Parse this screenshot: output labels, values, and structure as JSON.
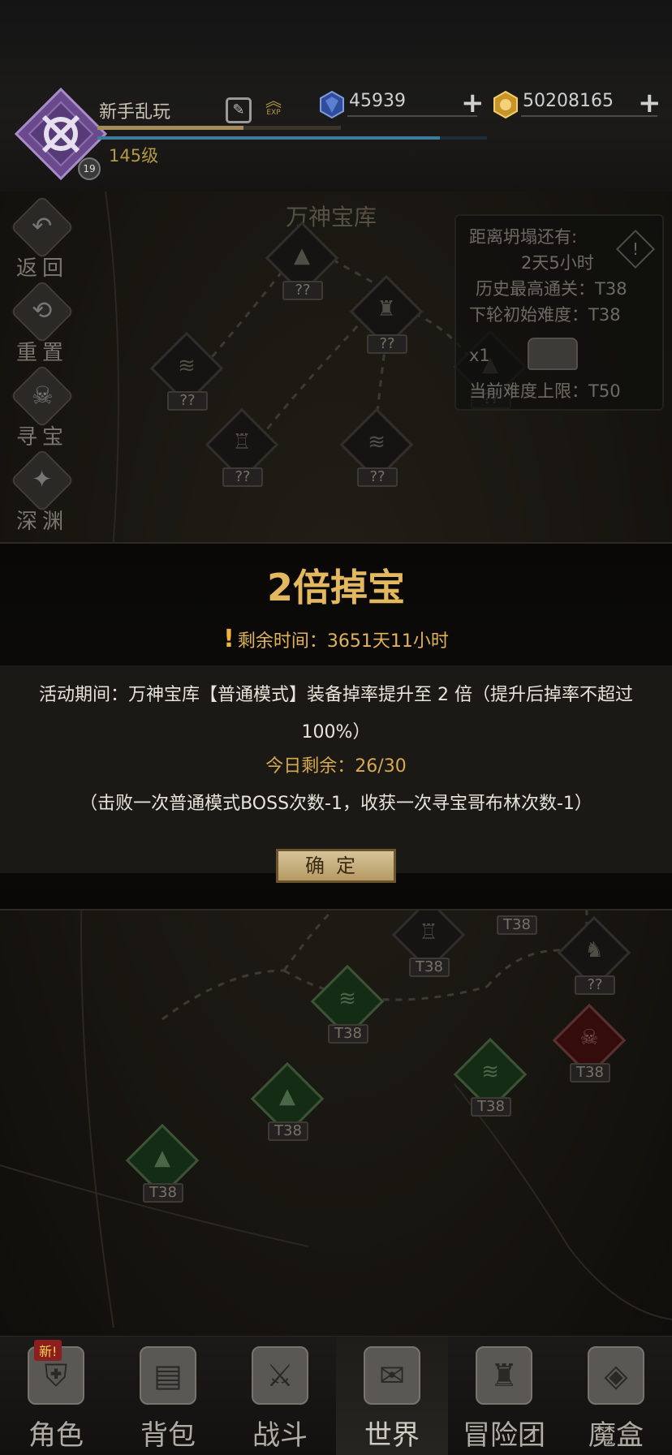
{
  "header": {
    "player_name": "新手乱玩",
    "player_level": "145级",
    "avatar_badge": "19",
    "exp_icon_label": "EXP",
    "exp_progress": 0.6,
    "mana_progress": 0.88,
    "currencies": [
      {
        "name": "diamond",
        "value": "45939",
        "icon": "blue-crystal-icon",
        "color": "#3d5fb5"
      },
      {
        "name": "gold",
        "value": "50208165",
        "icon": "gold-coin-icon",
        "color": "#d4a93a"
      }
    ]
  },
  "map": {
    "title": "万神宝库",
    "side_menu": [
      {
        "label": "返回",
        "icon": "return-arrow-icon"
      },
      {
        "label": "重置",
        "icon": "reset-icon"
      },
      {
        "label": "寻宝",
        "icon": "skull-icon"
      },
      {
        "label": "深渊",
        "icon": "abyss-mask-icon"
      }
    ],
    "info_panel": {
      "collapse_label": "距离坍塌还有:",
      "collapse_time": "2天5小时",
      "history_best": "历史最高通关：T38",
      "next_difficulty": "下轮初始难度：T38",
      "chest_count": "x1",
      "current_limit": "当前难度上限：T50"
    },
    "nodes": [
      {
        "tag": "??",
        "state": "locked",
        "icon": "ruins-icon"
      },
      {
        "tag": "??",
        "state": "locked",
        "icon": "pyramid-icon"
      },
      {
        "tag": "??",
        "state": "locked",
        "icon": "tower-icon"
      },
      {
        "tag": "??",
        "state": "locked",
        "icon": "swamp-icon"
      },
      {
        "tag": "??",
        "state": "locked",
        "icon": "castle-icon"
      },
      {
        "tag": "??",
        "state": "locked",
        "icon": "swamp-icon"
      },
      {
        "tag": "??",
        "state": "locked",
        "icon": "pyramid-icon"
      },
      {
        "tag": "T38",
        "state": "cleared",
        "icon": "castle-icon"
      },
      {
        "tag": "T38",
        "state": "cleared",
        "icon": "marsh-icon"
      },
      {
        "tag": "??",
        "state": "locked",
        "icon": "beast-icon"
      },
      {
        "tag": "T38",
        "state": "boss",
        "icon": "dragon-icon"
      },
      {
        "tag": "T38",
        "state": "cleared",
        "icon": "marsh-icon"
      },
      {
        "tag": "T38",
        "state": "cleared",
        "icon": "pyramid-icon"
      },
      {
        "tag": "T38",
        "state": "cleared",
        "icon": "pyramid-icon"
      }
    ],
    "marker_tag": "T38"
  },
  "modal": {
    "title": "2倍掉宝",
    "timer": "剩余时间：3651天11小时",
    "description": "活动期间：万神宝库【普通模式】装备掉率提升至 2 倍（提升后掉率不超过 100%）",
    "remaining_today": "今日剩余：26/30",
    "note": "（击败一次普通模式BOSS次数-1，收获一次寻宝哥布林次数-1）",
    "confirm_label": "确定"
  },
  "bottom_nav": [
    {
      "label": "角色",
      "icon": "helmet-icon",
      "badge": "新!"
    },
    {
      "label": "背包",
      "icon": "backpack-icon"
    },
    {
      "label": "战斗",
      "icon": "sword-shield-icon"
    },
    {
      "label": "世界",
      "icon": "world-scroll-icon",
      "active": true
    },
    {
      "label": "冒险团",
      "icon": "castle-guild-icon"
    },
    {
      "label": "魔盒",
      "icon": "magic-cube-icon"
    }
  ]
}
